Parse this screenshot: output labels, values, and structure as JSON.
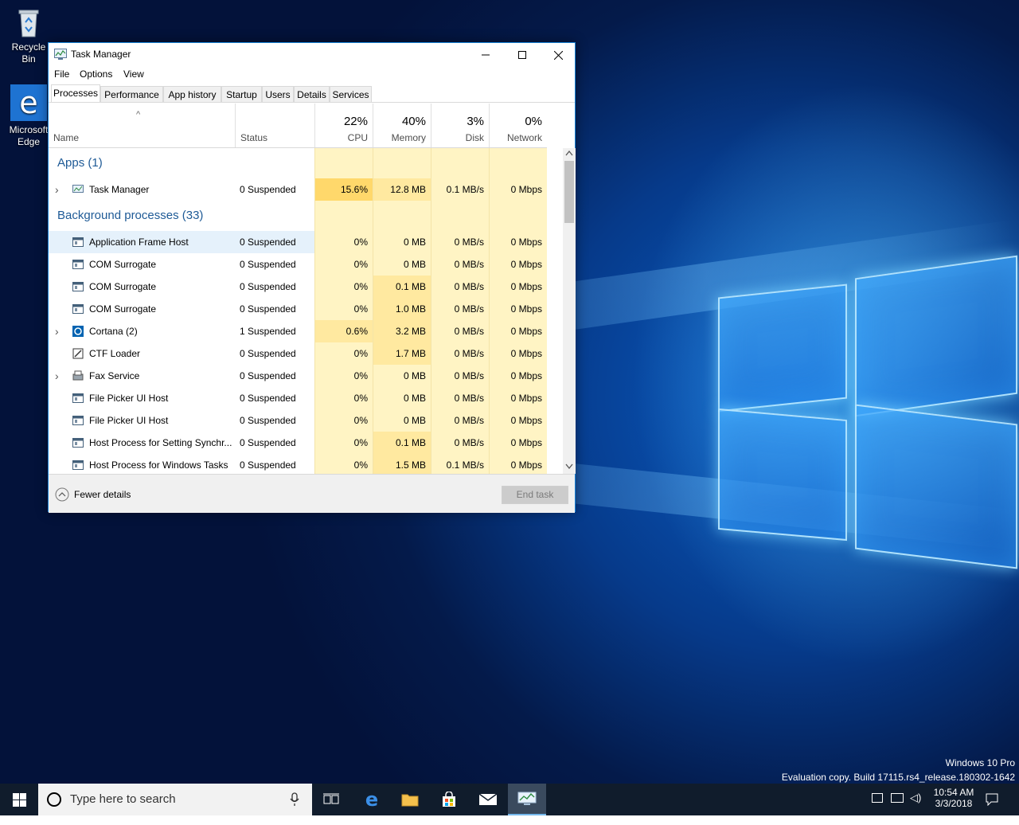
{
  "desktop": {
    "icons": [
      {
        "label": "Recycle Bin",
        "icon": "recycle-bin-icon"
      },
      {
        "label": "Microsoft Edge",
        "icon": "edge-icon"
      }
    ],
    "watermark_line1": "Windows 10 Pro",
    "watermark_line2": "Evaluation copy. Build 17115.rs4_release.180302-1642"
  },
  "window": {
    "title": "Task Manager",
    "menu": [
      "File",
      "Options",
      "View"
    ],
    "tabs": [
      "Processes",
      "Performance",
      "App history",
      "Startup",
      "Users",
      "Details",
      "Services"
    ],
    "active_tab": "Processes",
    "columns": {
      "name": "Name",
      "status": "Status",
      "cpu": {
        "pct": "22%",
        "label": "CPU"
      },
      "memory": {
        "pct": "40%",
        "label": "Memory"
      },
      "disk": {
        "pct": "3%",
        "label": "Disk"
      },
      "network": {
        "pct": "0%",
        "label": "Network"
      }
    },
    "groups": {
      "apps": "Apps (1)",
      "background": "Background processes (33)"
    },
    "apps": [
      {
        "name": "Task Manager",
        "status": "0 Suspended",
        "cpu": "15.6%",
        "memory": "12.8 MB",
        "disk": "0.1 MB/s",
        "network": "0 Mbps",
        "expandable": true,
        "icon": "task-manager-icon"
      }
    ],
    "background": [
      {
        "name": "Application Frame Host",
        "status": "0 Suspended",
        "cpu": "0%",
        "memory": "0 MB",
        "disk": "0 MB/s",
        "network": "0 Mbps",
        "expandable": false,
        "icon": "window-app-icon"
      },
      {
        "name": "COM Surrogate",
        "status": "0 Suspended",
        "cpu": "0%",
        "memory": "0 MB",
        "disk": "0 MB/s",
        "network": "0 Mbps",
        "expandable": false,
        "icon": "window-app-icon"
      },
      {
        "name": "COM Surrogate",
        "status": "0 Suspended",
        "cpu": "0%",
        "memory": "0.1 MB",
        "disk": "0 MB/s",
        "network": "0 Mbps",
        "expandable": false,
        "icon": "window-app-icon"
      },
      {
        "name": "COM Surrogate",
        "status": "0 Suspended",
        "cpu": "0%",
        "memory": "1.0 MB",
        "disk": "0 MB/s",
        "network": "0 Mbps",
        "expandable": false,
        "icon": "window-app-icon"
      },
      {
        "name": "Cortana (2)",
        "status": "1 Suspended",
        "cpu": "0.6%",
        "memory": "3.2 MB",
        "disk": "0 MB/s",
        "network": "0 Mbps",
        "expandable": true,
        "icon": "cortana-icon"
      },
      {
        "name": "CTF Loader",
        "status": "0 Suspended",
        "cpu": "0%",
        "memory": "1.7 MB",
        "disk": "0 MB/s",
        "network": "0 Mbps",
        "expandable": false,
        "icon": "ctf-loader-icon"
      },
      {
        "name": "Fax Service",
        "status": "0 Suspended",
        "cpu": "0%",
        "memory": "0 MB",
        "disk": "0 MB/s",
        "network": "0 Mbps",
        "expandable": true,
        "icon": "fax-icon"
      },
      {
        "name": "File Picker UI Host",
        "status": "0 Suspended",
        "cpu": "0%",
        "memory": "0 MB",
        "disk": "0 MB/s",
        "network": "0 Mbps",
        "expandable": false,
        "icon": "window-app-icon"
      },
      {
        "name": "File Picker UI Host",
        "status": "0 Suspended",
        "cpu": "0%",
        "memory": "0 MB",
        "disk": "0 MB/s",
        "network": "0 Mbps",
        "expandable": false,
        "icon": "window-app-icon"
      },
      {
        "name": "Host Process for Setting Synchr...",
        "status": "0 Suspended",
        "cpu": "0%",
        "memory": "0.1 MB",
        "disk": "0 MB/s",
        "network": "0 Mbps",
        "expandable": false,
        "icon": "window-app-icon"
      },
      {
        "name": "Host Process for Windows Tasks",
        "status": "0 Suspended",
        "cpu": "0%",
        "memory": "1.5 MB",
        "disk": "0.1 MB/s",
        "network": "0 Mbps",
        "expandable": false,
        "icon": "window-app-icon"
      }
    ],
    "footer": {
      "fewer_details": "Fewer details",
      "end_task": "End task"
    }
  },
  "taskbar": {
    "search_placeholder": "Type here to search",
    "time": "10:54 AM",
    "date": "3/3/2018"
  },
  "colors": {
    "heat_light": "#fff4c4",
    "heat_mid": "#ffe9a0",
    "heat_strong": "#ffd86b",
    "group_text": "#1e5a96"
  }
}
